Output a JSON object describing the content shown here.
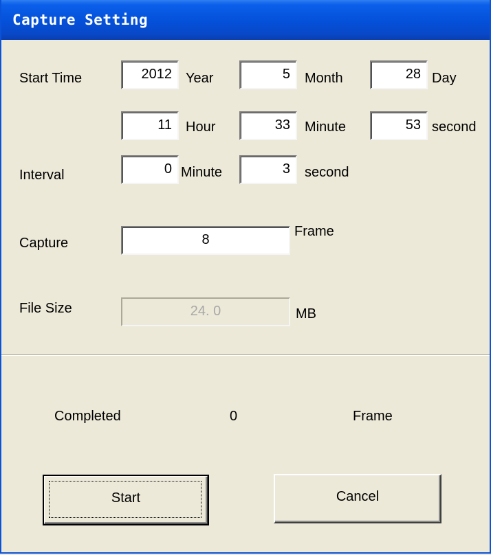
{
  "window": {
    "title": "Capture Setting"
  },
  "start_time": {
    "label": "Start Time",
    "year": "2012",
    "year_unit": "Year",
    "month": "5",
    "month_unit": "Month",
    "day": "28",
    "day_unit": "Day",
    "hour": "11",
    "hour_unit": "Hour",
    "minute": "33",
    "minute_unit": "Minute",
    "second": "53",
    "second_unit": "second"
  },
  "interval": {
    "label": "Interval",
    "minute": "0",
    "minute_unit": "Minute",
    "second": "3",
    "second_unit": "second"
  },
  "capture": {
    "label": "Capture",
    "value": "8",
    "unit": "Frame"
  },
  "file_size": {
    "label": "File Size",
    "value": "24. 0",
    "unit": "MB"
  },
  "completed": {
    "label": "Completed",
    "value": "0",
    "unit": "Frame"
  },
  "buttons": {
    "start": "Start",
    "cancel": "Cancel"
  }
}
